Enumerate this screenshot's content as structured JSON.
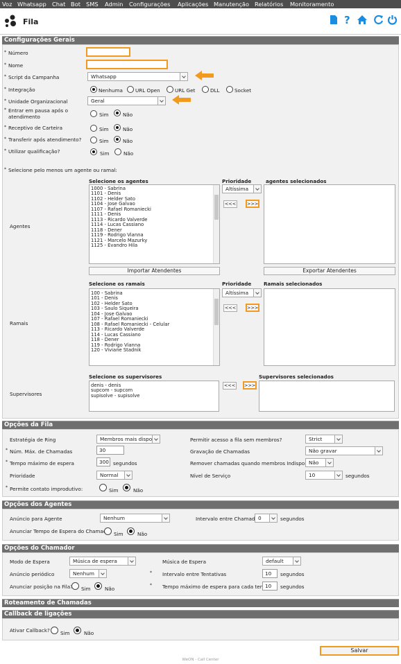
{
  "menu": [
    "Voz",
    "Whatsapp",
    "Chat",
    "Bot",
    "SMS",
    "Admin",
    "Configurações",
    "Aplicações",
    "Manutenção",
    "Relatórios",
    "Monitoramento"
  ],
  "page_title": "Fila",
  "colors": {
    "accent": "#f29a1e",
    "icon_blue": "#1b8de0",
    "section_bg": "#6f6f6f",
    "menu_bg": "#4d4d4d"
  },
  "toolbar_icons": [
    "document-icon",
    "help-icon",
    "home-icon",
    "refresh-icon",
    "power-icon"
  ],
  "sections": {
    "geral": "Configurações Gerais",
    "fila": "Opções da Fila",
    "agentes": "Opções dos Agentes",
    "chamador": "Opções do Chamador",
    "roteamento": "Roteamento de Chamadas",
    "callback": "Callback de ligações"
  },
  "geral": {
    "numero_label": "Número",
    "numero_value": "",
    "nome_label": "Nome",
    "nome_value": "",
    "script_label": "Script da Campanha",
    "script_value": "Whatsapp",
    "integracao_label": "Integração",
    "integracao_options": [
      "Nenhuma",
      "URL Open",
      "URL Get",
      "DLL",
      "Socket"
    ],
    "unidade_label": "Unidade Organizacional",
    "unidade_value": "Geral",
    "pausa_label": "Entrar em pausa após o atendimento",
    "receptivo_label": "Receptivo de Carteira",
    "transferir_label": "Transferir após atendimento?",
    "qualificacao_label": "Utilizar qualificação?",
    "sim": "Sim",
    "nao": "Não",
    "selecione_label": "Selecione pelo menos um agente ou ramal:"
  },
  "agentes": {
    "row_label": "Agentes",
    "list_header": "Selecione os agentes",
    "prioridade_header": "Prioridade",
    "prioridade_value": "Altíssima",
    "selected_header": "agentes selecionados",
    "items": [
      "1000 - Sabrina",
      "1101 - Denis",
      "1102 - Helder Sato",
      "1104 - Jose Galvao",
      "1107 - Rafael Romaniecki",
      "1111 - Denis",
      "1113 - Ricardo Valverde",
      "1114 - Lucas Cassiano",
      "1118 - Dener",
      "1119 - Rodrigo Vianna",
      "1121 - Marcelo Mazurky",
      "1125 - Evandro Hila"
    ],
    "btn_remove": "<<<",
    "btn_add": ">>>",
    "import_label": "Importar Atendentes",
    "export_label": "Exportar Atendentes"
  },
  "ramais": {
    "row_label": "Ramais",
    "list_header": "Selecione os ramais",
    "prioridade_header": "Prioridade",
    "prioridade_value": "Altíssima",
    "selected_header": "Ramais selecionados",
    "items": [
      "100 - Sabrina",
      "101 - Denis",
      "102 - Helder Sato",
      "103 - Saulo Siqueira",
      "104 - Jose Galvao",
      "107 - Rafael Romaniecki",
      "108 - Rafael Romaniecki - Celular",
      "113 - Ricardo Valverde",
      "114 - Lucas Cassiano",
      "118 - Dener",
      "119 - Rodrigo Vianna",
      "120 - Viviane Stadnik"
    ],
    "btn_remove": "<<<",
    "btn_add": ">>>"
  },
  "supervisores": {
    "row_label": "Supervisores",
    "list_header": "Selecione os supervisores",
    "selected_header": "Supervisores selecionados",
    "items": [
      "denis - denis",
      "supcom - supcom",
      "supisolve - supisolve"
    ],
    "btn_remove": "<<<",
    "btn_add": ">>>"
  },
  "fila": {
    "estrategia_label": "Estratégia de Ring",
    "estrategia_value": "Membros mais disponíveis",
    "permitir_label": "Permitir acesso a fila sem membros?",
    "permitir_value": "Strict",
    "max_label": "Núm. Máx. de Chamadas",
    "max_value": "30",
    "gravacao_label": "Gravação de Chamadas",
    "gravacao_value": "Não gravar",
    "tempo_label": "Tempo máximo de espera",
    "tempo_value": "300",
    "tempo_unit": "segundos",
    "remover_label": "Remover chamadas quando membros Indisponíveis",
    "remover_value": "Não",
    "prioridade_label": "Prioridade",
    "prioridade_value": "Normal",
    "nivel_label": "Nível de Serviço",
    "nivel_value": "10",
    "nivel_unit": "segundos",
    "improdutivo_label": "Permite contato improdutivo:"
  },
  "opc_agentes": {
    "anuncio_label": "Anúncio para Agente",
    "anuncio_value": "Nenhum",
    "intervalo_label": "Intervalo entre Chamadas",
    "intervalo_value": "0",
    "intervalo_unit": "segundos",
    "anunciar_label": "Anunciar Tempo de Espera do Chamador"
  },
  "chamador": {
    "modo_label": "Modo de Espera",
    "modo_value": "Música de espera",
    "musica_label": "Música de Espera",
    "musica_value": "default",
    "periodico_label": "Anúncio periódico",
    "periodico_value": "Nenhum",
    "tentativas_label": "Intervalo entre Tentativas",
    "tentativas_value": "10",
    "tentativas_unit": "segundos",
    "posicao_label": "Anunciar posição na Fila?",
    "tempo_tentativa_label": "Tempo máximo de espera para cada tentativa",
    "tempo_tentativa_value": "10",
    "tempo_tentativa_unit": "segundos"
  },
  "callback": {
    "ativar_label": "Ativar Callback?"
  },
  "salvar_label": "Salvar",
  "footer": "WeON - Call Center"
}
